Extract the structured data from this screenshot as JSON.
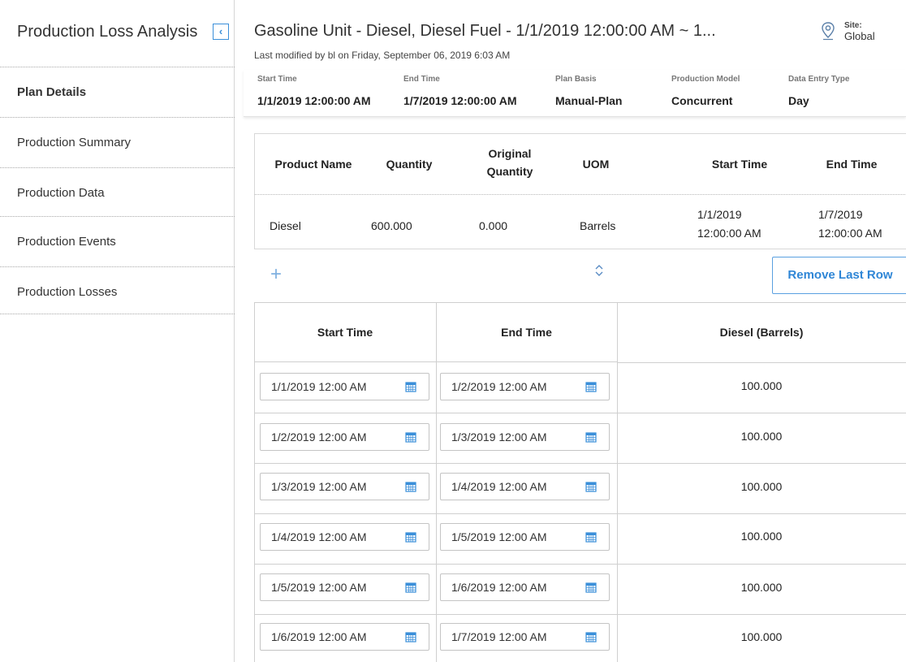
{
  "sidebar": {
    "title": "Production Loss Analysis",
    "collapse_glyph": "‹",
    "items": [
      {
        "label": "Plan Details",
        "active": true
      },
      {
        "label": "Production Summary",
        "active": false
      },
      {
        "label": "Production Data",
        "active": false
      },
      {
        "label": "Production Events",
        "active": false
      },
      {
        "label": "Production Losses",
        "active": false
      }
    ]
  },
  "header": {
    "title": "Gasoline Unit - Diesel, Diesel Fuel - 1/1/2019 12:00:00 AM ~ 1...",
    "subtitle": "Last modified by bl on Friday, September 06, 2019 6:03 AM",
    "site_label": "Site:",
    "site_value": "Global",
    "site_icon": "location-pin-icon"
  },
  "plan_info": [
    {
      "label": "Start Time",
      "value": "1/1/2019 12:00:00 AM"
    },
    {
      "label": "End Time",
      "value": "1/7/2019 12:00:00 AM"
    },
    {
      "label": "Plan Basis",
      "value": "Manual-Plan"
    },
    {
      "label": "Production Model",
      "value": "Concurrent"
    },
    {
      "label": "Data Entry Type",
      "value": "Day"
    }
  ],
  "product_table": {
    "headers": {
      "product_name": "Product Name",
      "quantity": "Quantity",
      "original_quantity_1": "Original",
      "original_quantity_2": "Quantity",
      "uom": "UOM",
      "start_time": "Start Time",
      "end_time": "End Time"
    },
    "row": {
      "product_name": "Diesel",
      "quantity": "600.000",
      "original_quantity": "0.000",
      "uom": "Barrels",
      "start_date": "1/1/2019",
      "start_clock": "12:00:00 AM",
      "end_date": "1/7/2019",
      "end_clock": "12:00:00 AM"
    }
  },
  "toolbar": {
    "add_glyph": "+",
    "remove_last_row_label": "Remove Last Row"
  },
  "grid": {
    "headers": {
      "start_time": "Start Time",
      "end_time": "End Time",
      "diesel": "Diesel (Barrels)"
    },
    "rows": [
      {
        "start": "1/1/2019 12:00 AM",
        "end": "1/2/2019 12:00 AM",
        "value": "100.000"
      },
      {
        "start": "1/2/2019 12:00 AM",
        "end": "1/3/2019 12:00 AM",
        "value": "100.000"
      },
      {
        "start": "1/3/2019 12:00 AM",
        "end": "1/4/2019 12:00 AM",
        "value": "100.000"
      },
      {
        "start": "1/4/2019 12:00 AM",
        "end": "1/5/2019 12:00 AM",
        "value": "100.000"
      },
      {
        "start": "1/5/2019 12:00 AM",
        "end": "1/6/2019 12:00 AM",
        "value": "100.000"
      },
      {
        "start": "1/6/2019 12:00 AM",
        "end": "1/7/2019 12:00 AM",
        "value": "100.000"
      }
    ]
  }
}
